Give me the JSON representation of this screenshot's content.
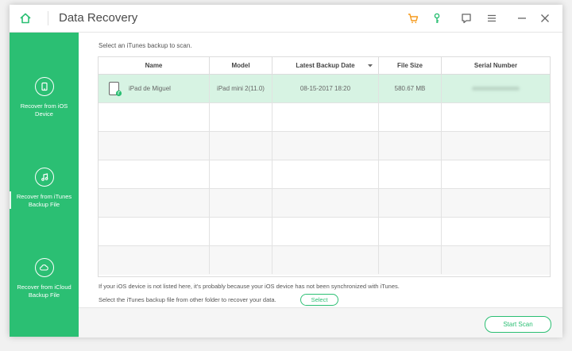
{
  "app": {
    "title": "Data Recovery",
    "accent_color": "#2bbf73",
    "selected_row_color": "#d7f3e3"
  },
  "titlebar": {
    "icons": [
      "home-icon",
      "cart-icon",
      "key-icon",
      "chat-icon",
      "menu-icon",
      "minimize-icon",
      "close-icon"
    ]
  },
  "sidebar": {
    "items": [
      {
        "label": "Recover from iOS Device",
        "icon": "phone-icon"
      },
      {
        "label": "Recover from iTunes Backup File",
        "icon": "music-note-icon",
        "active": true
      },
      {
        "label": "Recover from iCloud Backup File",
        "icon": "cloud-icon"
      }
    ]
  },
  "main": {
    "instruction": "Select an iTunes backup to scan.",
    "table": {
      "columns": [
        "Name",
        "Model",
        "Latest Backup Date",
        "File Size",
        "Serial Number"
      ],
      "rows": [
        {
          "name": "iPad de Miguel",
          "model": "iPad mini 2(11.0)",
          "date": "08-15-2017 18:20",
          "size": "580.67 MB",
          "serial": ""
        }
      ]
    },
    "note_line1": "If your iOS device is not listed here, it's probably because your iOS device has not been synchronized with iTunes.",
    "note_line2": "Select the iTunes backup file from other folder to recover your data.",
    "select_label": "Select",
    "start_scan_label": "Start Scan"
  }
}
